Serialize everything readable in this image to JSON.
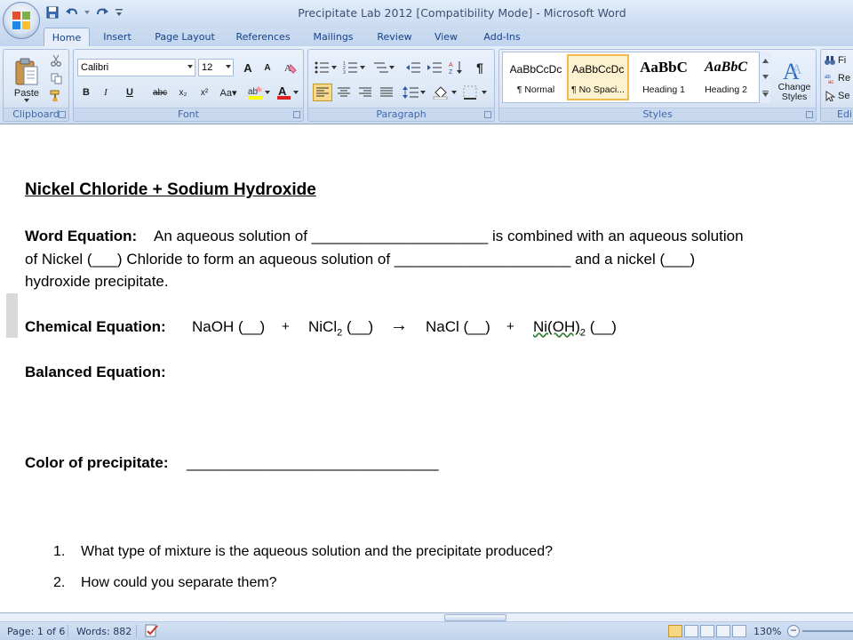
{
  "window": {
    "title": "Precipitate Lab 2012 [Compatibility Mode] - Microsoft Word"
  },
  "quick_access": {
    "icons": [
      "save-icon",
      "undo-icon",
      "redo-icon",
      "customize-icon"
    ]
  },
  "tabs": [
    {
      "label": "Home",
      "active": true
    },
    {
      "label": "Insert",
      "active": false
    },
    {
      "label": "Page Layout",
      "active": false
    },
    {
      "label": "References",
      "active": false
    },
    {
      "label": "Mailings",
      "active": false
    },
    {
      "label": "Review",
      "active": false
    },
    {
      "label": "View",
      "active": false
    },
    {
      "label": "Add-Ins",
      "active": false
    }
  ],
  "ribbon": {
    "clipboard": {
      "label": "Clipboard",
      "paste_label": "Paste"
    },
    "font": {
      "label": "Font",
      "font_name": "Calibri",
      "font_size": "12"
    },
    "paragraph": {
      "label": "Paragraph"
    },
    "styles": {
      "label": "Styles",
      "change_styles_line1": "Change",
      "change_styles_line2": "Styles",
      "items": [
        {
          "preview": "AaBbCcDc",
          "name": "¶ Normal",
          "selected": false
        },
        {
          "preview": "AaBbCcDc",
          "name": "¶ No Spaci...",
          "selected": true
        },
        {
          "preview": "AaBbC",
          "name": "Heading 1",
          "selected": false
        },
        {
          "preview": "AaBbC",
          "name": "Heading 2",
          "selected": false
        }
      ]
    },
    "editing": {
      "label": "Edi",
      "find": "Fi",
      "replace": "Re",
      "select": "Se"
    }
  },
  "document": {
    "title": "Nickel Chloride + Sodium Hydroxide",
    "word_equation_label": "Word Equation:",
    "word_equation_line1": "An aqueous solution of _____________________  is combined with an aqueous solution",
    "word_equation_line2": "of Nickel (___) Chloride to form an aqueous solution of _____________________  and a nickel (___)",
    "word_equation_line3": "hydroxide precipitate.",
    "chemical_equation_label": "Chemical Equation:",
    "eq_reactant1": "NaOH (__)",
    "eq_plus1": "+",
    "eq_reactant2_pre": "NiCl",
    "eq_reactant2_sub": "2",
    "eq_reactant2_post": " (__)",
    "eq_arrow": "→",
    "eq_product1": "NaCl (__)",
    "eq_plus2": "+",
    "eq_product2_pre": "Ni(OH)",
    "eq_product2_sub": "2",
    "eq_product2_post": " (__)",
    "balanced_equation_label": "Balanced Equation:",
    "color_label": "Color of precipitate:",
    "color_blank": "______________________________",
    "questions": [
      {
        "number": "1.",
        "text": "What type of mixture is the aqueous solution and the precipitate produced?"
      },
      {
        "number": "2.",
        "text": "How could you separate them?"
      }
    ]
  },
  "status": {
    "page": "Page: 1 of 6",
    "words": "Words: 882",
    "zoom": "130%"
  },
  "colors": {
    "ribbon_blue": "#dce8f7",
    "tab_text": "#15428b",
    "selected_style": "#f3b94e"
  }
}
